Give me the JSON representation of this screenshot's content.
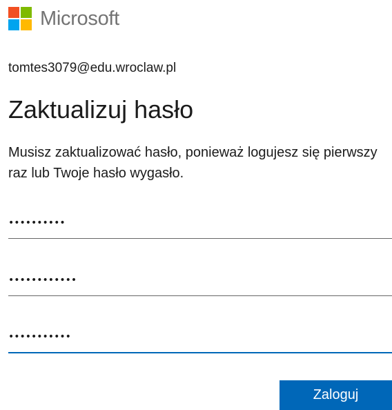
{
  "brand": {
    "name": "Microsoft",
    "logo_colors": [
      "#f25022",
      "#7fba00",
      "#00a4ef",
      "#ffb900"
    ],
    "logo_icon": "microsoft-logo-icon"
  },
  "account": {
    "email": "tomtes3079@edu.wroclaw.pl"
  },
  "page": {
    "title": "Zaktualizuj hasło",
    "description": "Musisz zaktualizować hasło, ponieważ logujesz się pierwszy raz lub Twoje hasło wygasło."
  },
  "form": {
    "current_password": "••••••••••",
    "new_password": "••••••••••••",
    "confirm_password": "•••••••••••",
    "submit_label": "Zaloguj"
  },
  "colors": {
    "accent": "#0067b8",
    "text": "#1b1b1b",
    "logo_text": "#737373"
  }
}
